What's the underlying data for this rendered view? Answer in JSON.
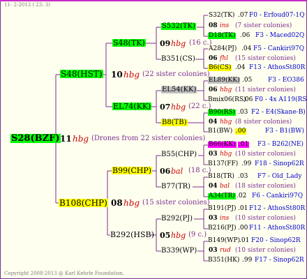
{
  "header": {
    "date": "11- 2-2013 ( 23: 3)"
  },
  "footer": {
    "copyright": "Copyright 2008-2013 @ Karl Kehrle Foundation."
  },
  "colors": {
    "green": "#00ff00",
    "yellow": "#ffff00",
    "grey": "#c0c0c0",
    "magenta": "#ff00ff",
    "lines": "#7a2f8f"
  },
  "root": {
    "name": "S28(BZF)",
    "num": "11",
    "hbg": "hbg",
    "note": "(Drones from 22 sister colonies)"
  },
  "gen1": [
    {
      "name": "S48(HST)",
      "num": "10",
      "hbg": "hbg",
      "note": "(22 sister colonies)"
    },
    {
      "name": "B108(CHP)",
      "num": "08",
      "hbg": "hbg",
      "note": "(15 sister colonies)"
    }
  ],
  "gen2": [
    {
      "name": "S48(TK)",
      "num": "09",
      "hbg": "hbg",
      "note": "(16 c.)"
    },
    {
      "name": "EL74(KK)",
      "num": "07",
      "hbg": "hbg",
      "note": "(22 c.)"
    },
    {
      "name": "B99(CHP)",
      "num": "06",
      "hbg": "bal",
      "note": "(18 c.)"
    },
    {
      "name": "B292(HSB)",
      "num": "05",
      "hbg": "hbg",
      "note": "(9 c.)"
    }
  ],
  "gen3": [
    {
      "name": "S532(TK)"
    },
    {
      "name": "B351(CS)"
    },
    {
      "name": "EL54(KK)"
    },
    {
      "name": "B8(TB)"
    },
    {
      "name": "B55(CHP)"
    },
    {
      "name": "B77(TR)"
    },
    {
      "name": "B292(PJ)"
    },
    {
      "name": "B339(WP)"
    }
  ],
  "gen4": [
    {
      "name": "S32(TK)",
      "val": ".07",
      "lab": "F0 - Erfoud07-1Q"
    },
    {
      "name": "D18(TK)",
      "val": ".06",
      "lab": "F3 - Maced02Q"
    },
    {
      "name": "A284(PJ)",
      "val": ".04",
      "lab": "F5 - Cankiri97Q"
    },
    {
      "name": "B6(CS)",
      "val": ".04",
      "lab": "F13 - AthosSt80R"
    },
    {
      "name": "EL89(KK)",
      "val": ".05",
      "lab": "F3 - EO386"
    },
    {
      "name": "Bmix06(RS)",
      "val": ".06",
      "lab": "F0 - 4x A119(RS)"
    },
    {
      "name": "B90(RS)",
      "val": ".03",
      "lab": "F2 - E4(Skane-B)"
    },
    {
      "name": "B1(BW)",
      "val": ".00",
      "lab": "F3 - B1(BW)"
    },
    {
      "name": "B66(KK)",
      "val": ".01",
      "lab": "F3 - B262(NE)"
    },
    {
      "name": "B137(FF)",
      "val": ".99",
      "lab": "F18 - Sinop62R"
    },
    {
      "name": "B18(TR)",
      "val": ".03",
      "lab": "F7 - Old_Lady"
    },
    {
      "name": "A34(TR)",
      "val": ".02",
      "lab": "F6 - Cankiri97Q"
    },
    {
      "name": "B191(PJ)",
      "val": ".01",
      "lab": "F12 - AthosSt80R"
    },
    {
      "name": "B216(PJ)",
      "val": ".00",
      "lab": "F11 - AthosSt80R"
    },
    {
      "name": "B149(WP)",
      "val": ".01",
      "lab": "F20 - Sinop62R"
    },
    {
      "name": "B351(HK)",
      "val": ".99",
      "lab": "F17 - Sinop62R"
    }
  ],
  "gen4mid": [
    {
      "num": "08",
      "hbg": "ins",
      "note": "(7 sister colonies)"
    },
    {
      "num": "06",
      "hbg": "fhl",
      "note": "(15 sister colonies)"
    },
    {
      "num": "06",
      "hbg": "hbg",
      "note": "(11 sister colonies)"
    },
    {
      "num": "04",
      "hbg": "hbg",
      "note": "(8 sister colonies)"
    },
    {
      "num": "03",
      "hbg": "hbg",
      "note": "(10 sister colonies)"
    },
    {
      "num": "04",
      "hbg": "bal",
      "note": "(18 sister colonies)"
    },
    {
      "num": "03",
      "hbg": "ins",
      "note": "(10 sister colonies)"
    },
    {
      "num": "03",
      "hbg": "rud",
      "note": "(10 sister colonies)"
    }
  ]
}
